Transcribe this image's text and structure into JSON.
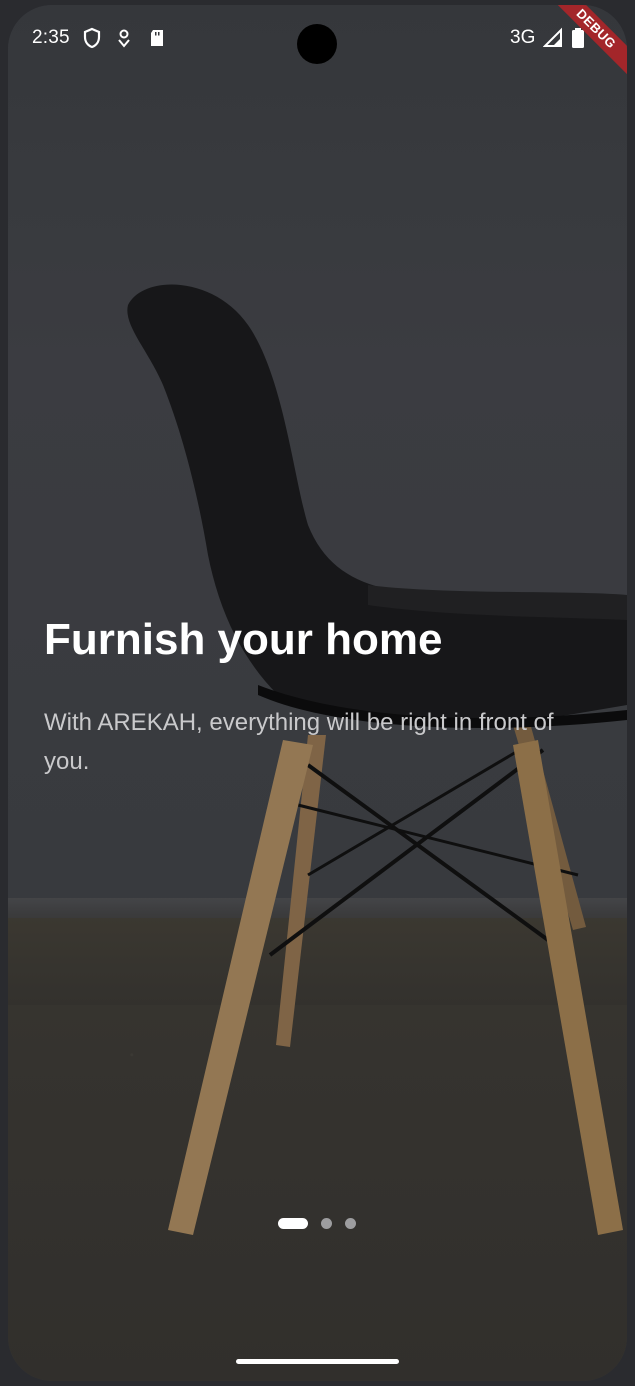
{
  "status_bar": {
    "time": "2:35",
    "network": "3G",
    "debug_label": "DEBUG"
  },
  "onboarding": {
    "title": "Furnish your home",
    "subtitle": "With AREKAH, everything will be right in front of you.",
    "page_count": 3,
    "active_page": 1
  },
  "icons": [
    "shield-icon",
    "location-icon",
    "sd-card-icon",
    "signal-icon",
    "battery-icon"
  ],
  "colors": {
    "wall": "#3d3f44",
    "floor": "#3a3833",
    "chair_seat": "#1b1b1d",
    "chair_legs": "#9a7a55",
    "title": "#ffffff",
    "subtitle": "#c9c9cb",
    "debug_banner": "#a3262a"
  }
}
